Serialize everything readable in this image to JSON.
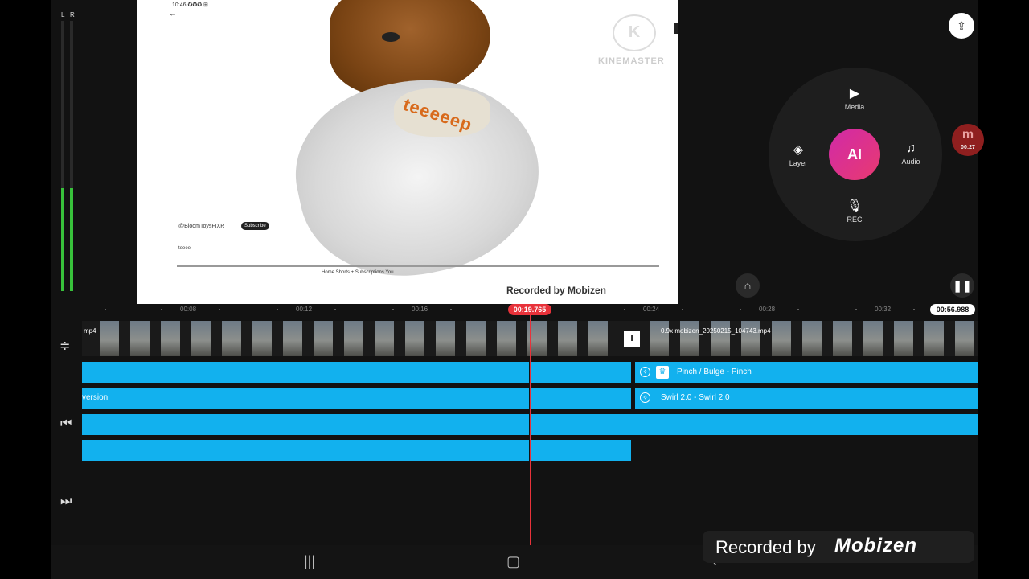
{
  "meter": {
    "left_label": "L",
    "right_label": "R",
    "left_level": 0.38,
    "right_level": 0.38
  },
  "preview": {
    "status_time": "10:46 ✪✪✪ ⊞",
    "overlay_text": "teeeeep",
    "km_logo": "K",
    "km_name": "KINEMASTER",
    "crown_icon": "♛",
    "channel_name": "@BloomToysFIXR",
    "subscribe_label": "Subscribe",
    "caption_small": "teeee",
    "nav_labels": "Home   Shorts   +   Subscriptions   You",
    "watermark": "Recorded by Mobizen"
  },
  "right_panel": {
    "media_label": "Media",
    "layer_label": "Layer",
    "audio_label": "Audio",
    "rec_label": "REC",
    "ai_label": "AI",
    "floating_badge_letter": "m",
    "floating_badge_time": "00:27"
  },
  "timeline": {
    "ruler_ticks": [
      "00:08",
      "00:12",
      "00:16",
      "00:24",
      "00:28",
      "00:32"
    ],
    "playhead_time": "00:19.765",
    "total_time": "00:56.988",
    "clip1_label": "mp4",
    "clip2_label": "0.9x mobizen_20250215_104743.mp4",
    "split_marker": "I",
    "track_pinch_label": "Pinch / Bulge - Pinch",
    "track_swirl_label": "Swirl 2.0 - Swirl 2.0",
    "track_inversion_label": "version"
  },
  "recording_badge": {
    "text": "Recorded by",
    "brand": "Mobizen"
  },
  "colors": {
    "track": "#12b1ee",
    "playhead": "#e8323a",
    "ai_gradient_start": "#d12aa8",
    "ai_gradient_end": "#e83a70"
  }
}
